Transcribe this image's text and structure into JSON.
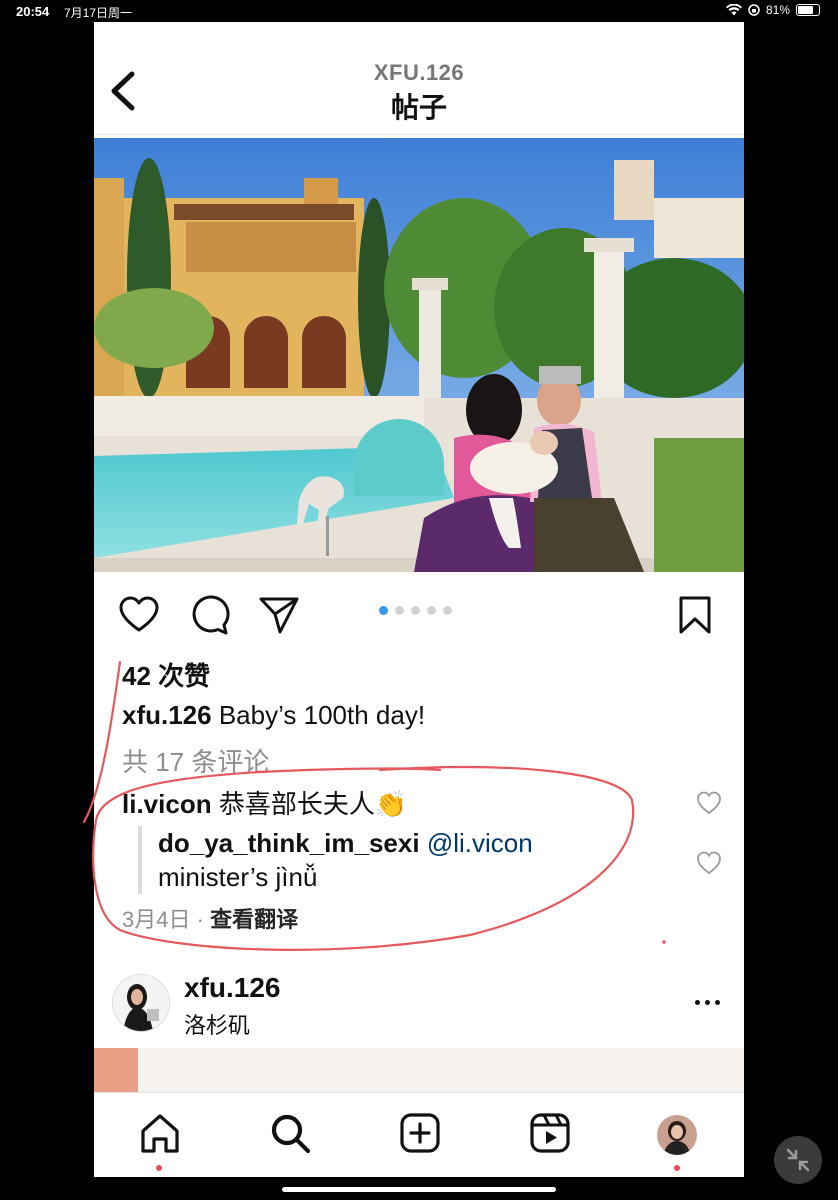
{
  "status": {
    "time": "20:54",
    "date": "7月17日周一",
    "battery": "81%"
  },
  "header": {
    "username": "XFU.126",
    "title": "帖子"
  },
  "post": {
    "likes": "42 次赞",
    "author": "xfu.126",
    "caption": "Baby’s 100th day!",
    "comment_count": "共 17 条评论",
    "carousel_total": 5,
    "carousel_active": 1
  },
  "comments": [
    {
      "user": "li.vicon",
      "text": "恭喜部长夫人",
      "emoji": "👏"
    }
  ],
  "reply": {
    "user": "do_ya_think_im_sexi",
    "mention": "@li.vicon",
    "text": "minister’s jìnǚ"
  },
  "comment_meta": {
    "date": "3月4日",
    "separator": "·",
    "translate": "查看翻译"
  },
  "next_post": {
    "username": "xfu.126",
    "location": "洛杉矶"
  },
  "colors": {
    "accent": "#3897f0",
    "annotation": "#e5585b",
    "notification": "#ed4956",
    "mention": "#00376b"
  }
}
